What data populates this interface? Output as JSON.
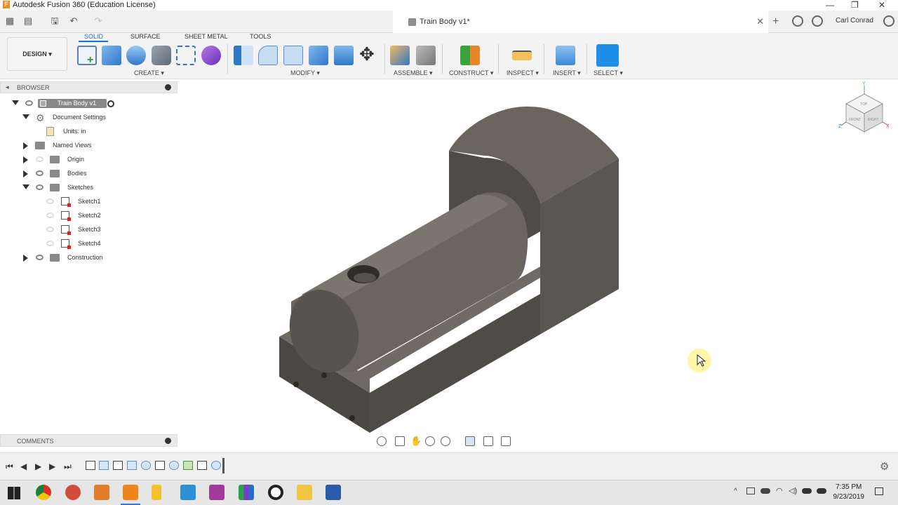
{
  "window": {
    "title": "Autodesk Fusion 360 (Education License)",
    "controls": [
      "—",
      "❐",
      "✕"
    ]
  },
  "doc_tab": {
    "title": "Train Body v1*",
    "close": "✕"
  },
  "user": {
    "name": "Carl Conrad"
  },
  "toolbar": {
    "tabs": [
      "SOLID",
      "SURFACE",
      "SHEET METAL",
      "TOOLS"
    ],
    "active_tab": "SOLID",
    "workspace": "DESIGN ▾",
    "groups": {
      "create": "CREATE ▾",
      "modify": "MODIFY ▾",
      "assemble": "ASSEMBLE ▾",
      "construct": "CONSTRUCT ▾",
      "inspect": "INSPECT ▾",
      "insert": "INSERT ▾",
      "select": "SELECT ▾"
    }
  },
  "browser": {
    "header": "BROWSER",
    "root": "Train Body v1",
    "items": {
      "doc_settings": "Document Settings",
      "units": "Units: in",
      "named_views": "Named Views",
      "origin": "Origin",
      "bodies": "Bodies",
      "sketches": "Sketches",
      "sketch1": "Sketch1",
      "sketch2": "Sketch2",
      "sketch3": "Sketch3",
      "sketch4": "Sketch4",
      "construction": "Construction"
    }
  },
  "comments": {
    "label": "COMMENTS"
  },
  "viewcube": {
    "faces": [
      "TOP",
      "FRONT",
      "RIGHT"
    ],
    "axes": [
      "Y",
      "Z",
      "X"
    ]
  },
  "taskbar": {
    "time": "7:35 PM",
    "date": "9/23/2019"
  },
  "colors": {
    "accent": "#1a74c9",
    "model_dark": "#4a4742",
    "model_mid": "#5e5a54",
    "model_light": "#77726b"
  }
}
